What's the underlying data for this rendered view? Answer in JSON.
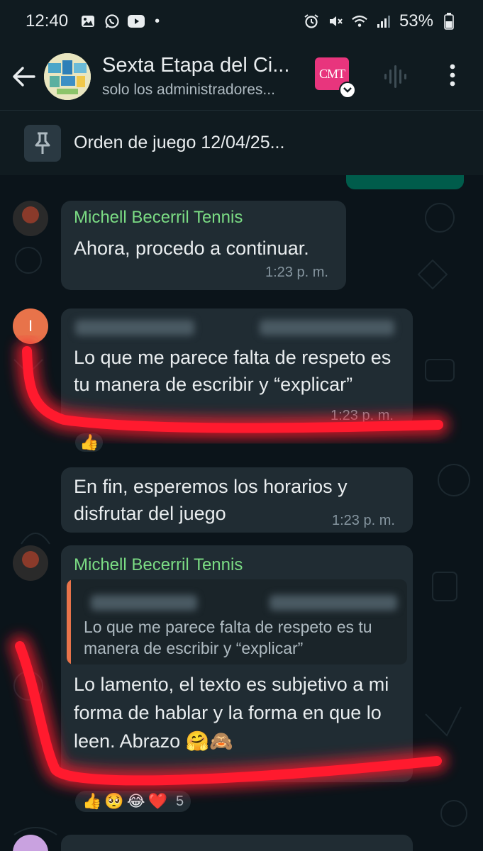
{
  "status_bar": {
    "time": "12:40",
    "dot": "•",
    "battery": "53%",
    "left_icons": [
      "gallery-icon",
      "whatsapp-icon",
      "youtube-icon"
    ],
    "right_icons": [
      "alarm-icon",
      "mute-icon",
      "wifi-icon",
      "signal-icon",
      "battery-icon"
    ]
  },
  "header": {
    "title": "Sexta Etapa del Ci...",
    "subtitle": "solo los administradores...",
    "logo_text": "CMT",
    "colors": {
      "background": "#101b20",
      "logo": "#e8357d"
    }
  },
  "pinned": {
    "text": "Orden de juego 12/04/25..."
  },
  "chat": {
    "messages": [
      {
        "sender": "Michell Becerril Tennis",
        "text": "Ahora, procedo a continuar.",
        "time": "1:23 p. m."
      },
      {
        "sender_initial": "I",
        "text": "Lo que me parece falta de respeto es tu manera de escribir y “explicar”",
        "time": "1:23 p. m.",
        "reaction": "👍"
      },
      {
        "text": "En fin, esperemos los horarios y disfrutar del juego",
        "time": "1:23 p. m."
      },
      {
        "sender": "Michell Becerril Tennis",
        "quoted_text": "Lo que me parece falta de respeto es tu manera de escribir y “explicar”",
        "text": "Lo lamento, el texto es subjetivo a mi forma de hablar y la forma en que lo leen. Abrazo 🤗🙈",
        "reactions": [
          "👍",
          "🥺",
          "😂",
          "❤️"
        ],
        "reaction_count": "5"
      }
    ],
    "colors": {
      "sender_name": "#7bdc84",
      "bubble": "#202c33",
      "annotation": "#ff1a2e",
      "quote_bar": "#e8734a",
      "initial_avatar": "#e8734a"
    }
  }
}
